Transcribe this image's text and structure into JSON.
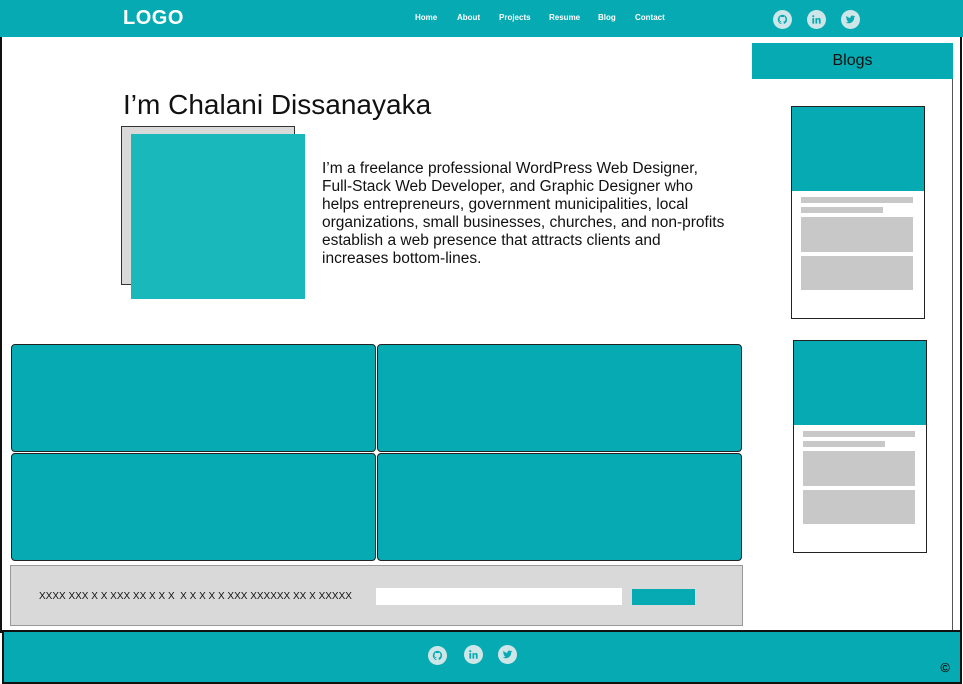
{
  "header": {
    "logo": "LOGO",
    "nav": [
      "Home",
      "About",
      "Projects",
      "Resume",
      "Blog",
      "Contact"
    ],
    "social_icons": [
      "github-icon",
      "linkedin-icon",
      "twitter-icon"
    ]
  },
  "intro": {
    "heading": "I’m Chalani Dissanayaka",
    "bio": "I’m a freelance professional WordPress Web Designer, Full-Stack Web Developer, and Graphic Designer who helps entrepreneurs, government municipalities, local organizations, small businesses, churches, and non-profits establish a web presence that attracts clients and increases bottom-lines."
  },
  "newsletter": {
    "text": "XXXX XXX X X XXX XX X X X  X X X X X XXX XXXXXX XX X XXXXX",
    "input_value": "",
    "button_label": ""
  },
  "sidebar": {
    "title": "Blogs"
  },
  "footer": {
    "social_icons": [
      "github-icon",
      "linkedin-icon",
      "twitter-icon"
    ],
    "copyright": "©"
  },
  "colors": {
    "accent": "#06aab2",
    "placeholder_gray": "#c8c8c8",
    "panel_gray": "#d9d9d9"
  }
}
